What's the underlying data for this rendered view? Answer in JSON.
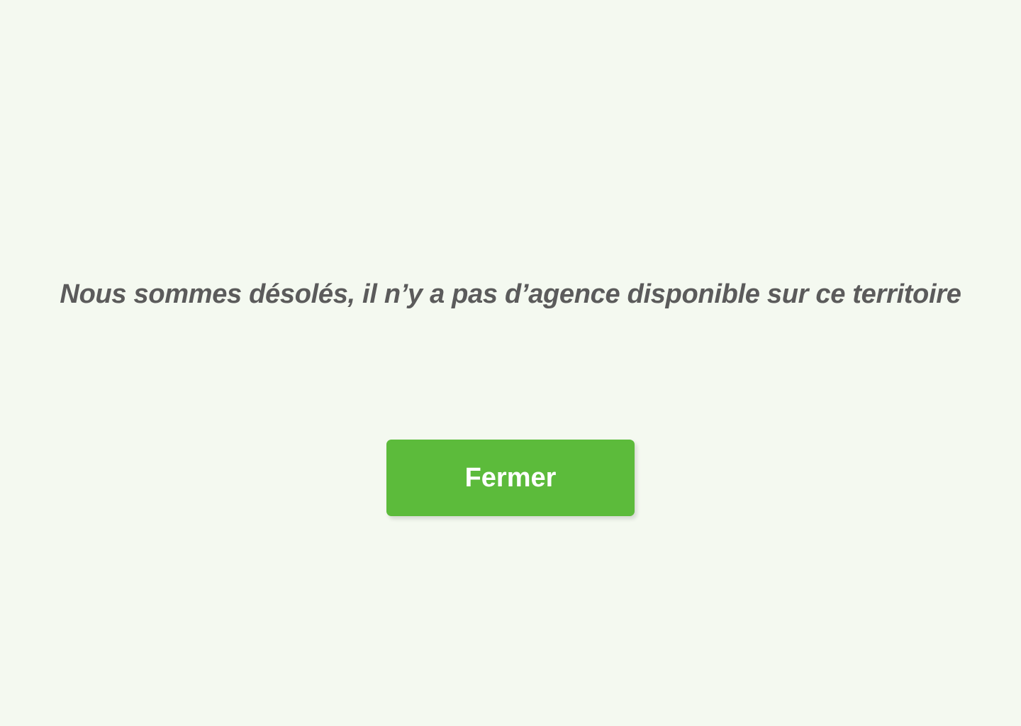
{
  "dialog": {
    "message": "Nous sommes désolés, il n’y a pas d’agence disponible sur ce territoire",
    "close_label": "Fermer"
  },
  "colors": {
    "background": "#f4f9f0",
    "text": "#5b5b5b",
    "button": "#5cbb3b",
    "button_text": "#ffffff"
  }
}
